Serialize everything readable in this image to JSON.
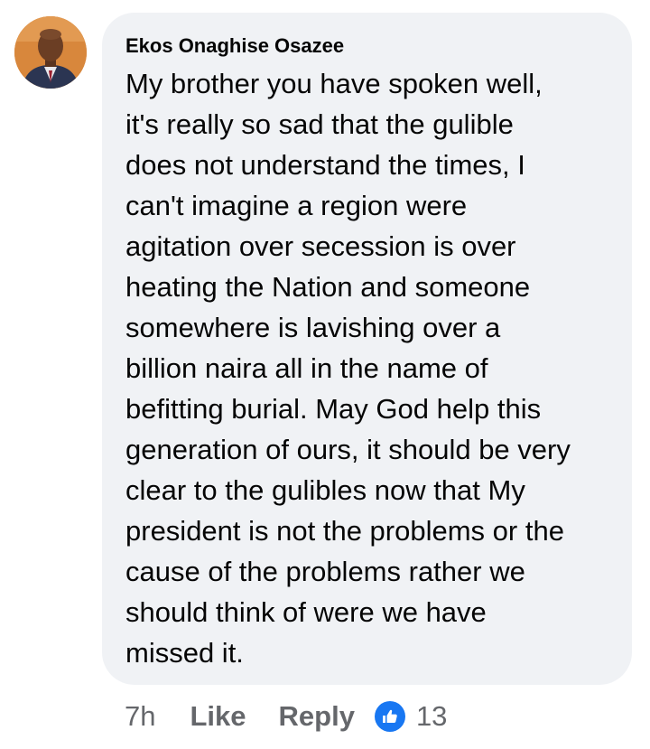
{
  "comment": {
    "author": "Ekos Onaghise Osazee",
    "lines": [
      "My brother you have spoken well,",
      "it's really so sad that the gulible",
      "does not understand the times, I",
      "can't imagine a region were",
      "agitation over secession is over",
      "heating the Nation and someone",
      "somewhere is lavishing over a",
      "billion naira all in the name of",
      "befitting burial. May God help this",
      "generation of ours, it should be very",
      "clear to the gulibles now that My",
      "president is not the problems or the",
      "cause of the problems rather we",
      "should think of were we have",
      "missed it."
    ]
  },
  "actions": {
    "time": "7h",
    "like_label": "Like",
    "reply_label": "Reply",
    "reaction_icon": "like-thumb-icon",
    "reaction_count": "13"
  },
  "colors": {
    "bubble_bg": "#f0f2f5",
    "text": "#050505",
    "secondary_text": "#65676b",
    "like_blue": "#1877f2"
  }
}
